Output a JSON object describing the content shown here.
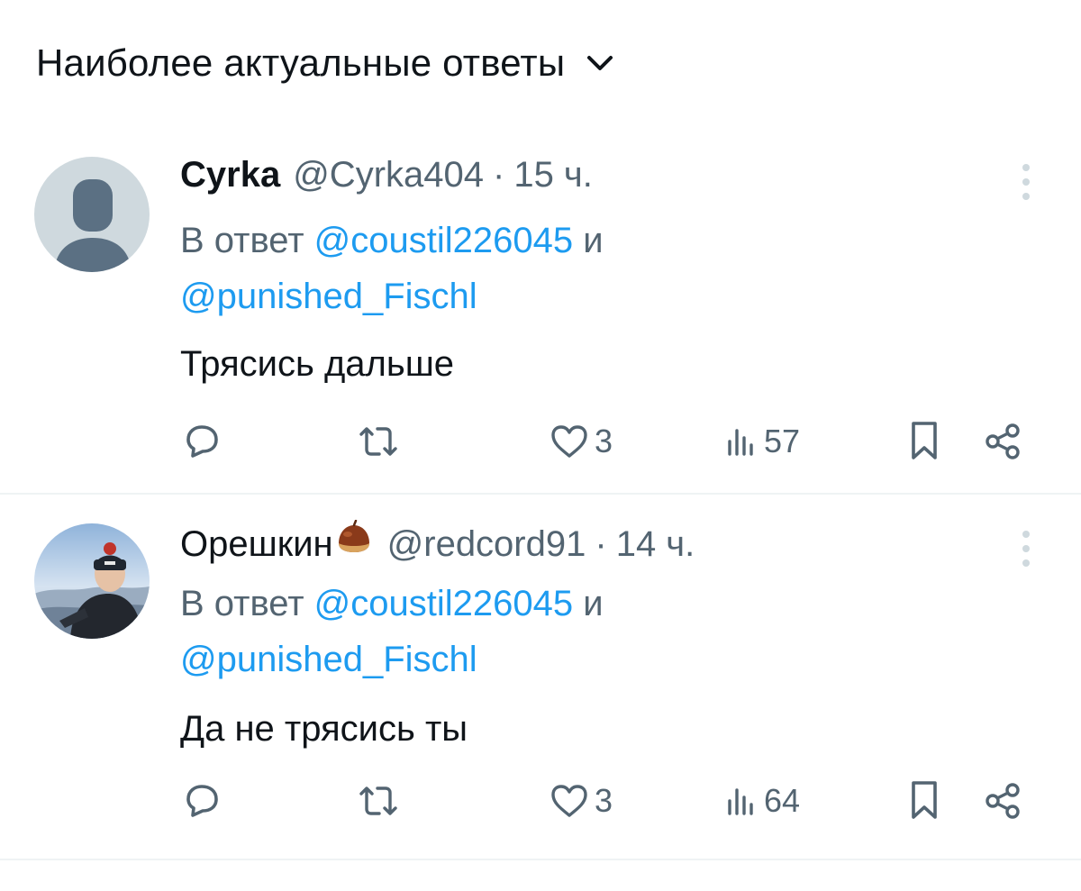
{
  "header": {
    "sort_label": "Наиболее актуальные ответы",
    "sort_icon": "chevron-down-icon"
  },
  "replies": [
    {
      "display_name": "Cyrka",
      "handle": "@Cyrka404",
      "separator": "·",
      "time": "15 ч.",
      "reply_prefix": "В ответ",
      "mention_1": "@coustil226045",
      "conjunction": "и",
      "mention_2": "@punished_Fischl",
      "text": "Трясись дальше",
      "likes": "3",
      "views": "57",
      "avatar": "default-profile-avatar"
    },
    {
      "display_name": "Орешкин",
      "name_emoji": "chestnut-emoji",
      "handle": "@redcord91",
      "separator": "·",
      "time": "14 ч.",
      "reply_prefix": "В ответ",
      "mention_1": "@coustil226045",
      "conjunction": "и",
      "mention_2": "@punished_Fischl",
      "text": "Да не трясись ты",
      "likes": "3",
      "views": "64",
      "avatar": "user-photo-avatar"
    }
  ],
  "colors": {
    "text": "#0f1419",
    "secondary": "#536471",
    "link": "#1d9bf0",
    "divider": "#eff3f4"
  }
}
